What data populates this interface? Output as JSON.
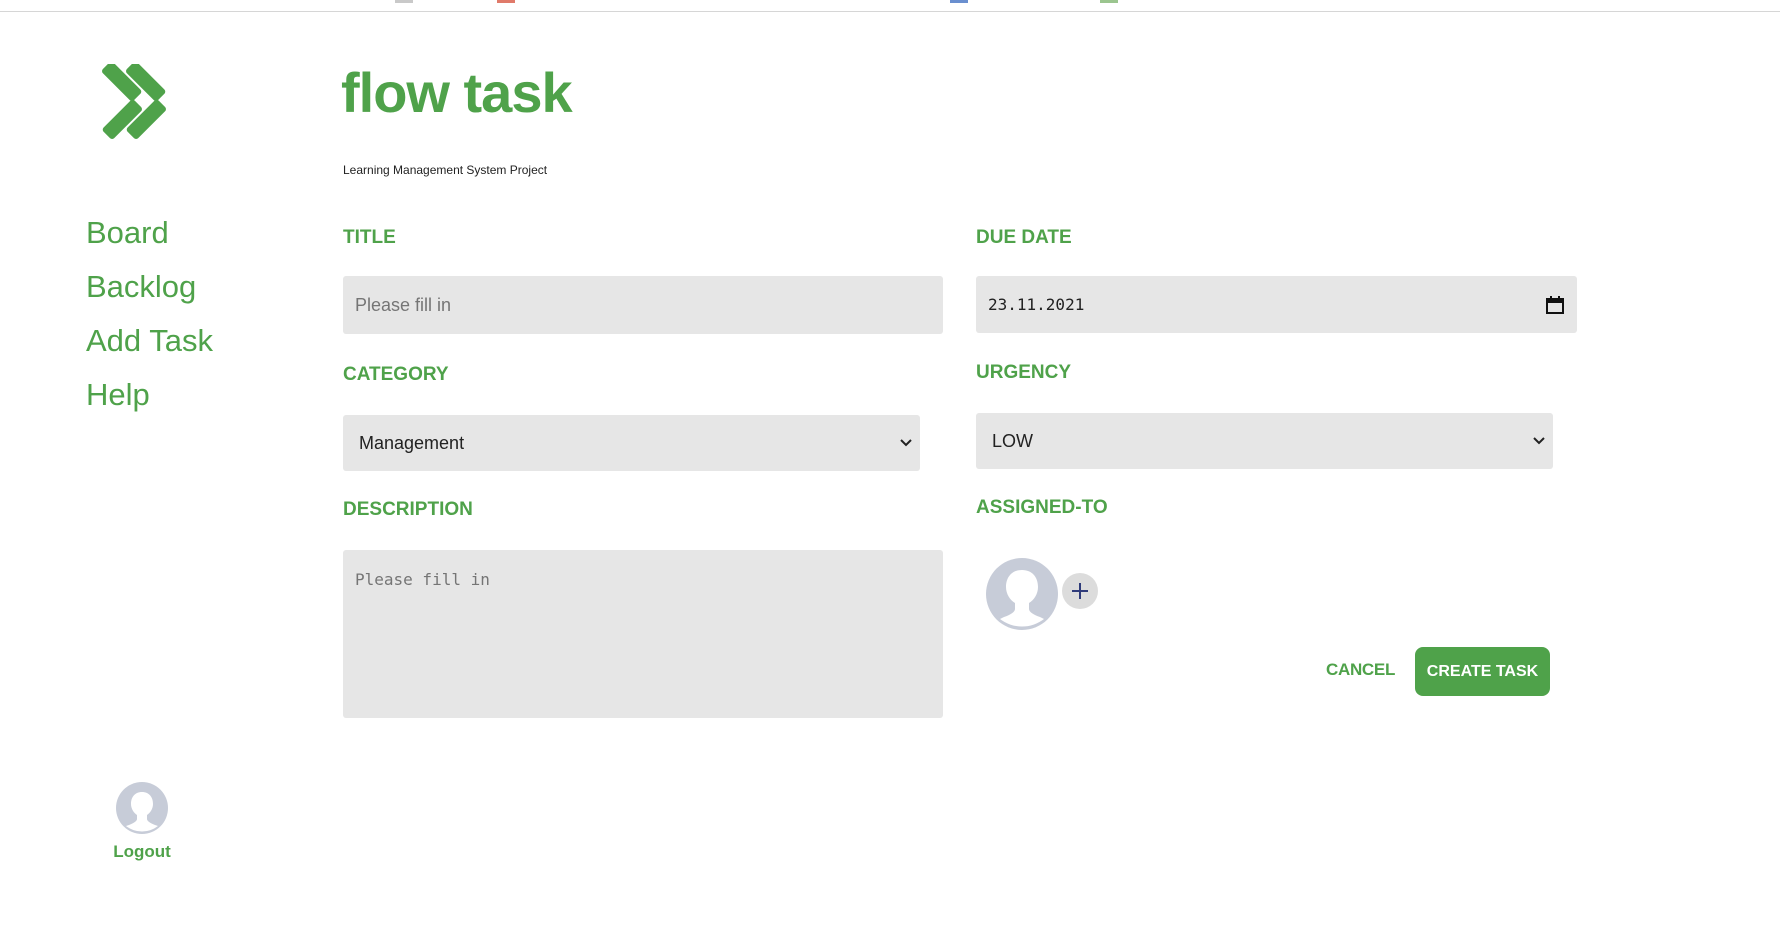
{
  "sidebar": {
    "logo": {
      "icon": "flow-task-logo-icon",
      "color": "#4fa24a"
    },
    "nav": [
      {
        "label": "Board"
      },
      {
        "label": "Backlog"
      },
      {
        "label": "Add Task"
      },
      {
        "label": "Help"
      }
    ],
    "logout": {
      "icon": "user-avatar-icon",
      "label": "Logout"
    }
  },
  "header": {
    "title": "flow task",
    "subtitle": "Learning Management System Project"
  },
  "form": {
    "title": {
      "label": "TITLE",
      "value": "",
      "placeholder": "Please fill in"
    },
    "category": {
      "label": "CATEGORY",
      "selected": "Management"
    },
    "description": {
      "label": "DESCRIPTION",
      "value": "",
      "placeholder": "Please fill in"
    },
    "due_date": {
      "label": "DUE DATE",
      "value": "23.11.2021",
      "icon": "calendar-icon"
    },
    "urgency": {
      "label": "URGENCY",
      "selected": "LOW"
    },
    "assigned_to": {
      "label": "ASSIGNED-TO",
      "avatar_icon": "user-avatar-icon",
      "add_icon": "plus-icon"
    }
  },
  "actions": {
    "cancel_label": "CANCEL",
    "create_label": "CREATE TASK"
  },
  "colors": {
    "accent": "#4fa24a",
    "field_bg": "#e6e6e6",
    "avatar": "#c7ccd8",
    "plus": "#2f3b7a"
  }
}
